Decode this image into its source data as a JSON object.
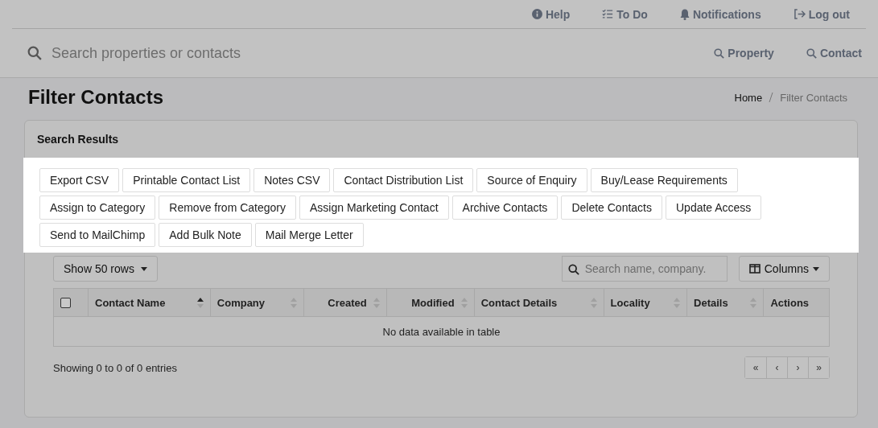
{
  "top_nav": [
    {
      "label": "Help"
    },
    {
      "label": "To Do"
    },
    {
      "label": "Notifications"
    },
    {
      "label": "Log out"
    }
  ],
  "search": {
    "placeholder": "Search properties or contacts",
    "scopes": [
      "Property",
      "Contact"
    ]
  },
  "page": {
    "title": "Filter Contacts",
    "breadcrumb": [
      "Home",
      "Filter Contacts"
    ]
  },
  "card": {
    "title": "Search Results",
    "actions": [
      [
        "Export CSV",
        "Printable Contact List",
        "Notes CSV",
        "Contact Distribution List",
        "Source of Enquiry",
        "Buy/Lease Requirements"
      ],
      [
        "Assign to Category",
        "Remove from Category",
        "Assign Marketing Contact",
        "Archive Contacts",
        "Delete Contacts",
        "Update Access"
      ],
      [
        "Send to MailChimp",
        "Add Bulk Note",
        "Mail Merge Letter"
      ]
    ],
    "rows_button": "Show 50 rows",
    "table_search": {
      "placeholder": "Search name, company."
    },
    "columns_button": "Columns",
    "table": {
      "select_all": {
        "checked": false
      },
      "columns": [
        {
          "label": "Contact Name",
          "sortable": true,
          "sorted": true
        },
        {
          "label": "Company",
          "sortable": true,
          "sorted": false
        },
        {
          "label": "Created",
          "sortable": true,
          "sorted": false
        },
        {
          "label": "Modified",
          "sortable": true,
          "sorted": false
        },
        {
          "label": "Contact Details",
          "sortable": true,
          "sorted": false
        },
        {
          "label": "Locality",
          "sortable": true,
          "sorted": false
        },
        {
          "label": "Details",
          "sortable": true,
          "sorted": false
        },
        {
          "label": "Actions",
          "sortable": false
        }
      ],
      "empty": "No data available in table"
    },
    "info": "Showing 0 to 0 of 0 entries",
    "pager": [
      "«",
      "‹",
      "›",
      "»"
    ]
  }
}
